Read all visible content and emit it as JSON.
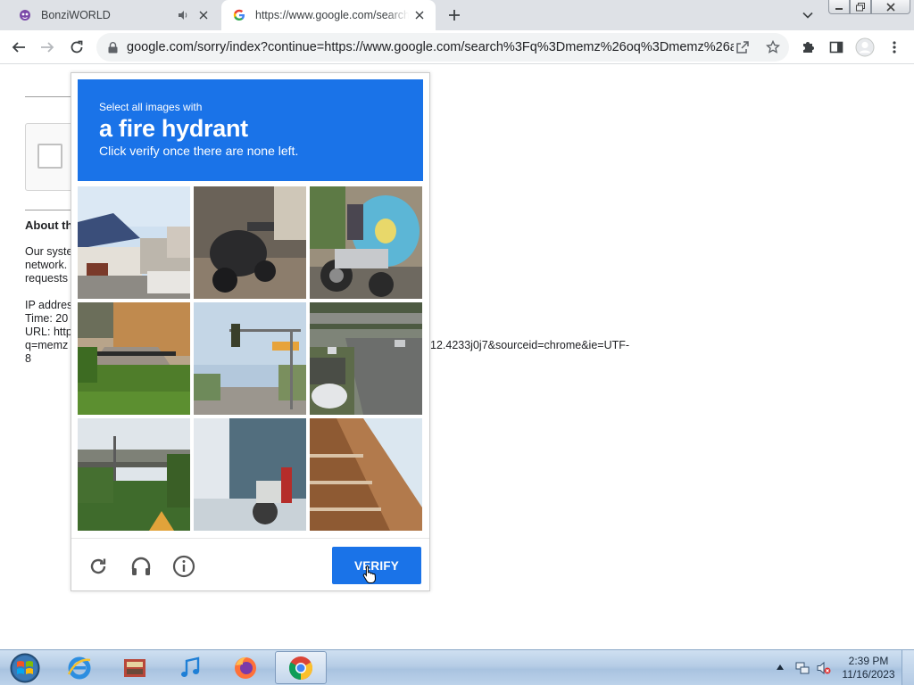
{
  "browser": {
    "tabs": [
      {
        "title": "BonziWORLD",
        "favicon": "bonzi-purple-icon",
        "audio": true
      },
      {
        "title": "https://www.google.com/search?",
        "favicon": "google-g-icon",
        "active": true
      }
    ],
    "toolbar": {
      "url": "google.com/sorry/index?continue=https://www.google.com/search%3Fq%3Dmemz%26oq%3Dmemz%26a..."
    }
  },
  "page": {
    "about_heading": "About th",
    "paragraph_lines": [
      "Our syste",
      "network.",
      "requests"
    ],
    "info_lines": [
      "IP addres",
      "Time: 20",
      "URL: http",
      "q=memz",
      "8"
    ],
    "url_tail": "12.4233j0j7&sourceid=chrome&ie=UTF-"
  },
  "captcha": {
    "prompt_small": "Select all images with",
    "prompt_target": "a fire hydrant",
    "prompt_instruction": "Click verify once there are none left.",
    "verify_label": "VERIFY",
    "accent": "#1a73e8",
    "tiles": [
      "house-with-solar-panels",
      "motorcycle-in-garage",
      "delivery-motorcycle",
      "porch-steps-and-lawn",
      "traffic-light-street",
      "highway-overpass-cars",
      "overpass-and-trees",
      "motorcycle-by-building",
      "building-balcony"
    ]
  },
  "taskbar": {
    "apps": [
      "internet-explorer-icon",
      "media-center-icon",
      "itunes-icon",
      "firefox-icon",
      "chrome-icon"
    ],
    "clock_time": "2:39 PM",
    "clock_date": "11/16/2023"
  }
}
